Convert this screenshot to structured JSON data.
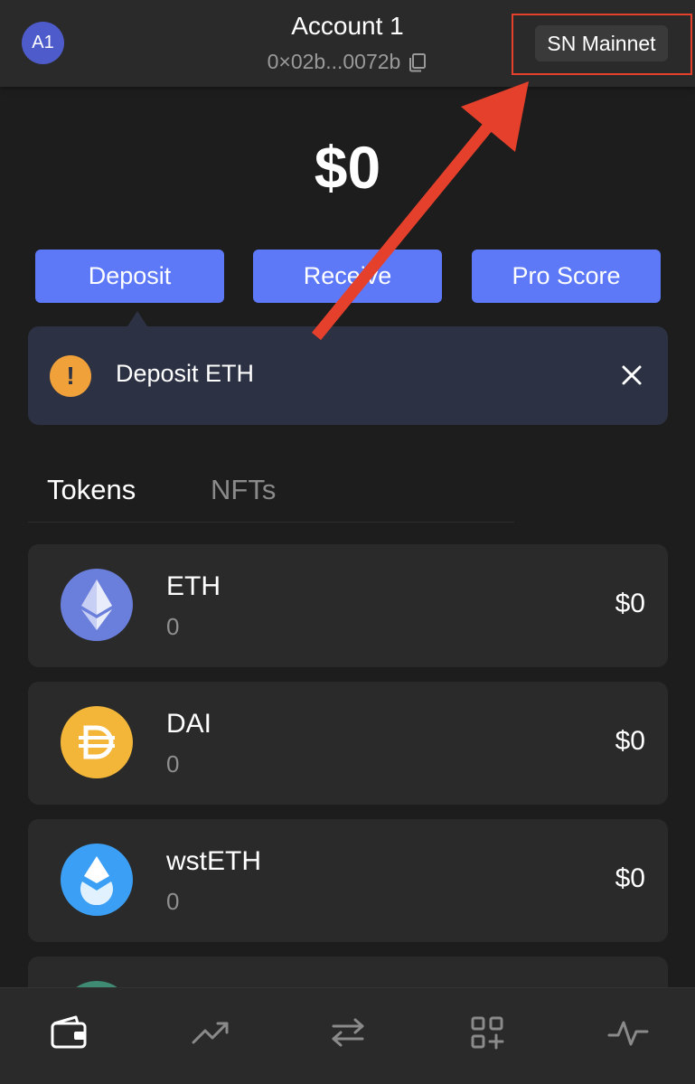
{
  "header": {
    "avatar_initials": "A1",
    "account_name": "Account 1",
    "address": "0×02b...0072b",
    "network_label": "SN Mainnet"
  },
  "balance": "$0",
  "actions": {
    "deposit": "Deposit",
    "receive": "Receive",
    "pro_score": "Pro Score"
  },
  "tooltip": {
    "text": "Deposit ETH"
  },
  "tabs": {
    "tokens": "Tokens",
    "nfts": "NFTs"
  },
  "tokens": [
    {
      "name": "ETH",
      "amount": "0",
      "value": "$0",
      "icon": "eth-icon"
    },
    {
      "name": "DAI",
      "amount": "0",
      "value": "$0",
      "icon": "dai-icon"
    },
    {
      "name": "wstETH",
      "amount": "0",
      "value": "$0",
      "icon": "wsteth-icon"
    }
  ],
  "nav": [
    "wallet-icon",
    "trending-icon",
    "swap-icon",
    "apps-add-icon",
    "activity-icon"
  ],
  "colors": {
    "accent": "#5d79f8",
    "annotation": "#e5402b",
    "warning": "#f0a13a"
  }
}
